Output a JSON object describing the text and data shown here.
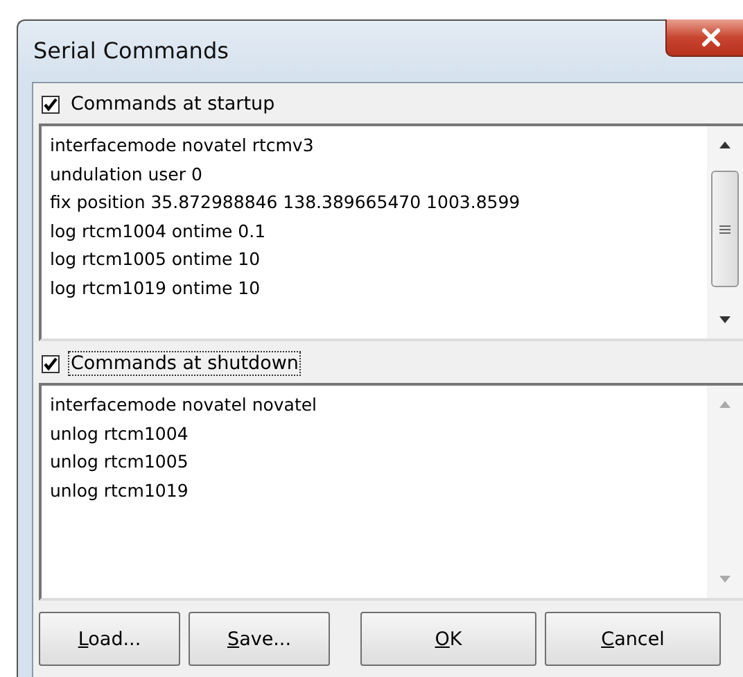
{
  "window": {
    "title": "Serial Commands"
  },
  "sections": [
    {
      "label": "Commands at startup",
      "checked": true,
      "focused": false,
      "scrollable": true,
      "lines": [
        "interfacemode novatel rtcmv3",
        "undulation user 0",
        "fix position 35.872988846 138.389665470 1003.8599",
        "log rtcm1004 ontime 0.1",
        "log rtcm1005 ontime 10",
        "log rtcm1019 ontime 10"
      ]
    },
    {
      "label": "Commands at shutdown",
      "checked": true,
      "focused": true,
      "scrollable": false,
      "lines": [
        "interfacemode novatel novatel",
        "unlog rtcm1004",
        "unlog rtcm1005",
        "unlog rtcm1019"
      ]
    }
  ],
  "buttons": [
    {
      "label": "Load...",
      "mnemonic_underlined": true
    },
    {
      "label": "Save...",
      "mnemonic_underlined": true
    },
    {
      "label": "OK",
      "mnemonic_underlined": true
    },
    {
      "label": "Cancel",
      "mnemonic_underlined": true
    }
  ]
}
